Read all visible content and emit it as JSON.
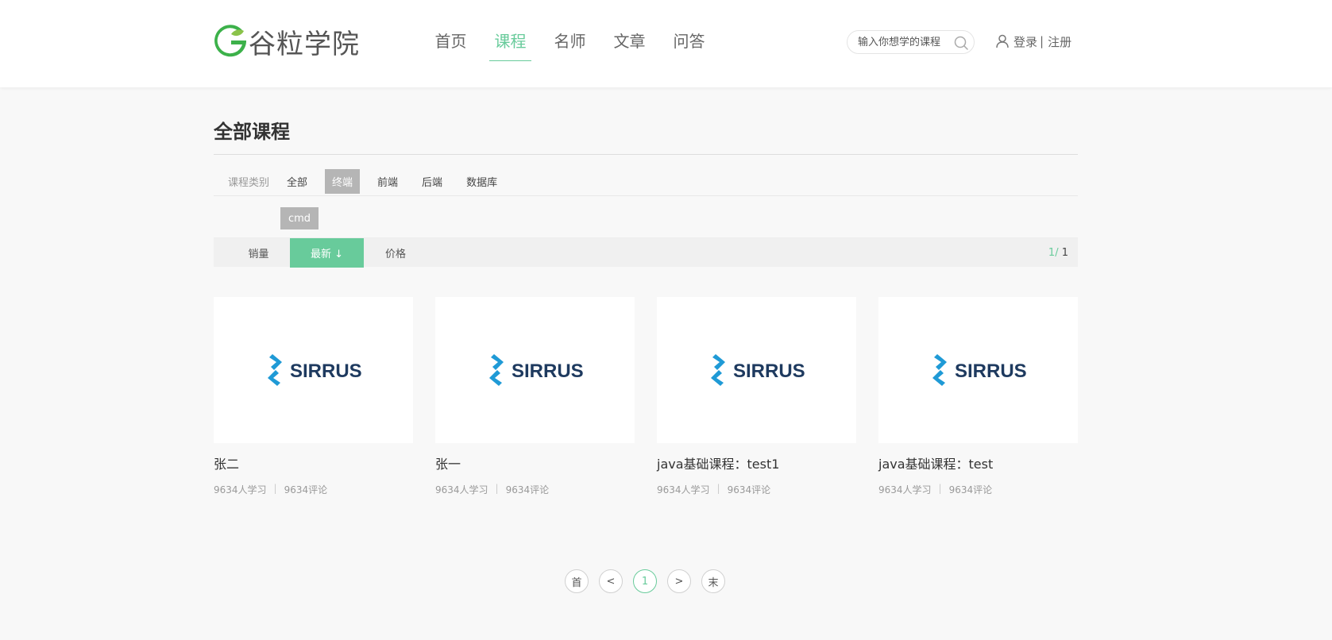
{
  "header": {
    "logo_text": "谷粒学院",
    "nav": [
      {
        "label": "首页",
        "active": false
      },
      {
        "label": "课程",
        "active": true
      },
      {
        "label": "名师",
        "active": false
      },
      {
        "label": "文章",
        "active": false
      },
      {
        "label": "问答",
        "active": false
      }
    ],
    "search_placeholder": "输入你想学的课程",
    "login_label": "登录",
    "separator": "|",
    "register_label": "注册"
  },
  "page_title": "全部课程",
  "categories": {
    "label": "课程类别",
    "items": [
      "全部",
      "终端",
      "前端",
      "后端",
      "数据库"
    ],
    "active_item": "终端",
    "sub_items": [
      "cmd"
    ]
  },
  "sort": {
    "sales_label": "销量",
    "new_label": "最新 ↓",
    "price_label": "价格",
    "page_current": "1",
    "page_sep": "/ ",
    "page_total": "1"
  },
  "courses": [
    {
      "title": "张二",
      "students": "9634人学习",
      "comments": "9634评论",
      "cover_logo": "SIRRUS"
    },
    {
      "title": "张一",
      "students": "9634人学习",
      "comments": "9634评论",
      "cover_logo": "SIRRUS"
    },
    {
      "title": "java基础课程：test1",
      "students": "9634人学习",
      "comments": "9634评论",
      "cover_logo": "SIRRUS"
    },
    {
      "title": "java基础课程：test",
      "students": "9634人学习",
      "comments": "9634评论",
      "cover_logo": "SIRRUS"
    }
  ],
  "meta_separator": "|",
  "pagination": {
    "first": "首",
    "prev": "<",
    "current": "1",
    "next": ">",
    "last": "末"
  },
  "colors": {
    "accent": "#68cb9b",
    "logo_green": "#3cb14a",
    "logo_leaf": "#8bc34a",
    "sirrus_blue": "#1f9ad6",
    "sirrus_navy": "#1e3a5f"
  },
  "icons": {
    "search": "search-icon",
    "user": "user-icon"
  }
}
